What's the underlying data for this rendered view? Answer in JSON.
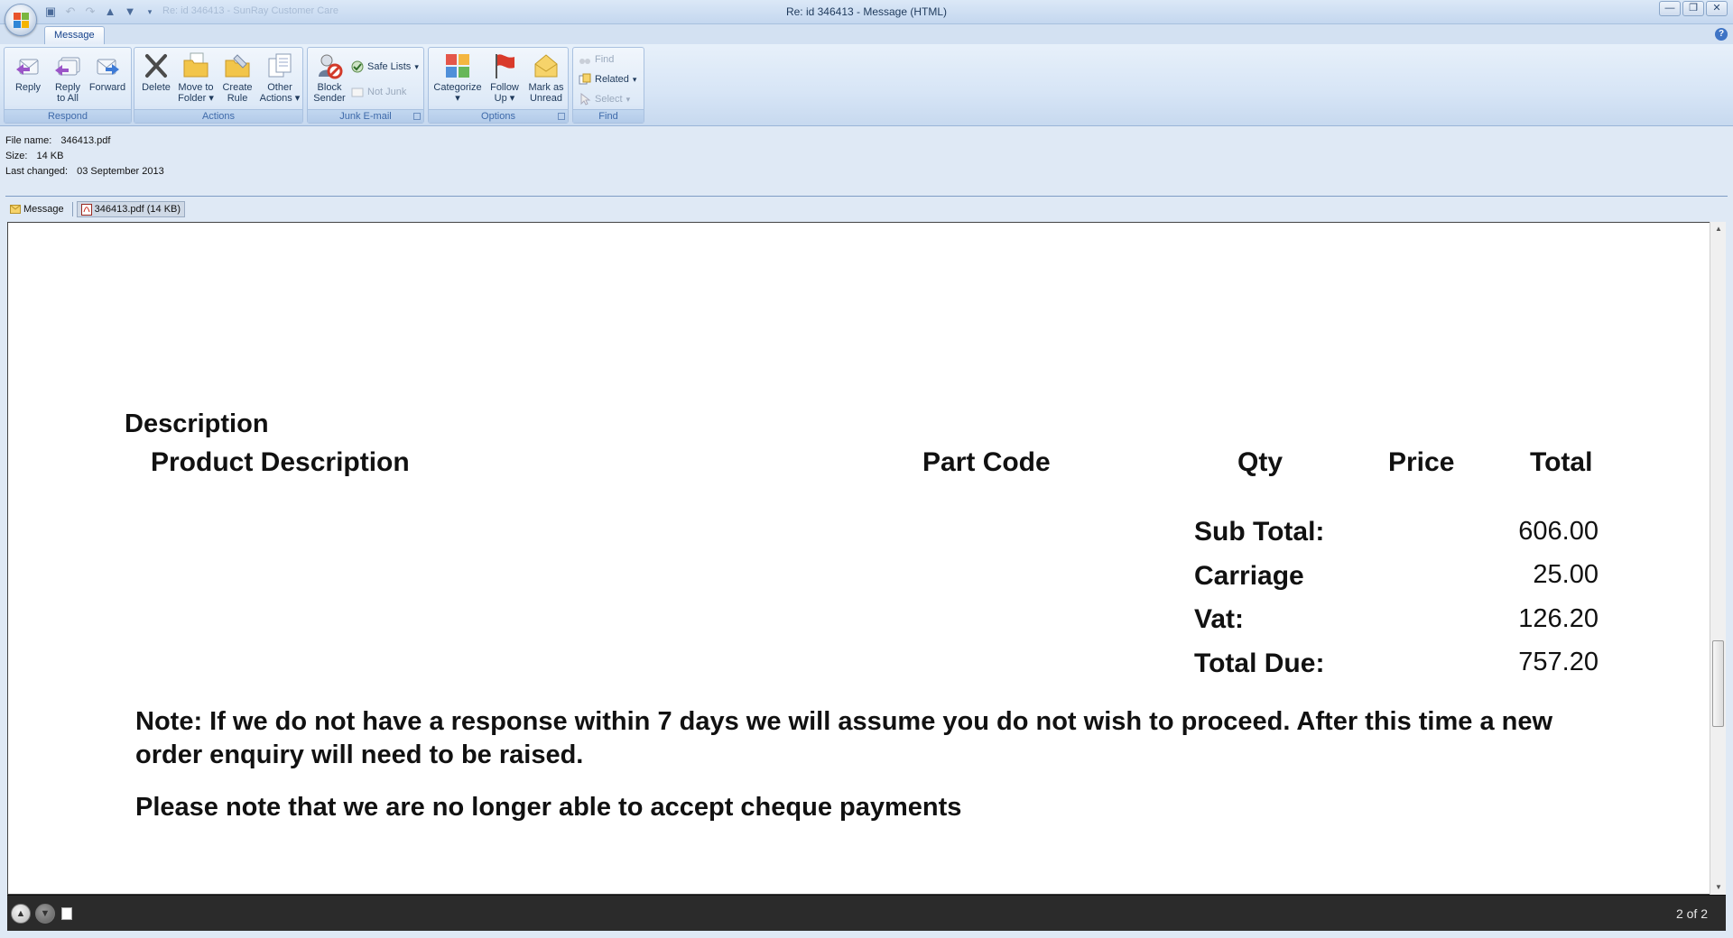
{
  "window": {
    "title": "Re: id 346413 - Message (HTML)",
    "faded_title": "Re: id 346413 - SunRay Customer Care"
  },
  "ribbon": {
    "tab": "Message",
    "groups": {
      "respond": {
        "label": "Respond",
        "reply": "Reply",
        "reply_all_1": "Reply",
        "reply_all_2": "to All",
        "forward": "Forward"
      },
      "actions": {
        "label": "Actions",
        "delete": "Delete",
        "move_1": "Move to",
        "move_2": "Folder",
        "create_1": "Create",
        "create_2": "Rule",
        "other_1": "Other",
        "other_2": "Actions"
      },
      "junk": {
        "label": "Junk E-mail",
        "block_1": "Block",
        "block_2": "Sender",
        "safe_lists": "Safe Lists",
        "not_junk": "Not Junk"
      },
      "options": {
        "label": "Options",
        "categorize": "Categorize",
        "follow_1": "Follow",
        "follow_2": "Up",
        "mark_1": "Mark as",
        "mark_2": "Unread"
      },
      "find": {
        "label": "Find",
        "find": "Find",
        "related": "Related",
        "select": "Select"
      }
    }
  },
  "file_info": {
    "name_label": "File name:",
    "name": "346413.pdf",
    "size_label": "Size:",
    "size": "14 KB",
    "changed_label": "Last changed:",
    "changed": "03 September 2013"
  },
  "attachments": {
    "message": "Message",
    "pdf": "346413.pdf (14 KB)"
  },
  "document": {
    "description_heading": "Description",
    "columns": {
      "product": "Product Description",
      "part": "Part Code",
      "qty": "Qty",
      "price": "Price",
      "total": "Total"
    },
    "totals": {
      "sub_total_label": "Sub Total:",
      "sub_total": "606.00",
      "carriage_label": "Carriage",
      "carriage": "25.00",
      "vat_label": "Vat:",
      "vat": "126.20",
      "total_due_label": "Total Due:",
      "total_due": "757.20"
    },
    "note": "Note: If we do not have a response within 7 days we will assume you do not wish to proceed. After this time a new order enquiry will need to be raised.",
    "cheque_note": "Please note that we are no longer able to accept cheque payments"
  },
  "viewer": {
    "page_indicator": "2 of 2"
  }
}
